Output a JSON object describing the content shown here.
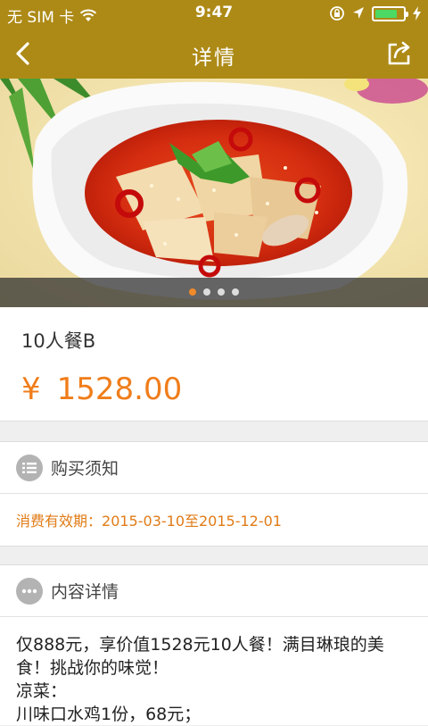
{
  "status_bar": {
    "carrier": "无 SIM 卡",
    "time": "9:47"
  },
  "nav": {
    "title": "详情"
  },
  "hero": {
    "slide_count": 4,
    "active_slide": 1
  },
  "product": {
    "name": "10人餐B",
    "currency": "¥",
    "price": "1528.00"
  },
  "purchase_notice": {
    "title": "购买须知",
    "validity_label": "消费有效期：",
    "validity_value": "2015-03-10至2015-12-01"
  },
  "content_details": {
    "title": "内容详情",
    "lines": [
      "仅888元，享价值1528元10人餐！满目琳琅的美",
      "食！挑战你的味觉！",
      "凉菜：",
      "川味口水鸡1份，68元；"
    ]
  },
  "colors": {
    "brand": "#ad8a16",
    "price": "#f07d1a",
    "validity": "#e07b17"
  }
}
